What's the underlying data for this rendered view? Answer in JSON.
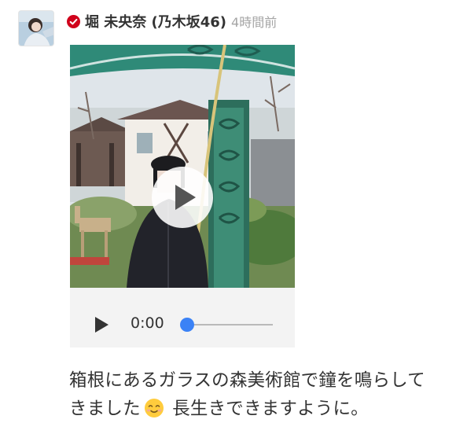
{
  "post": {
    "author": "堀 未央奈 (乃木坂46)",
    "time": "4時間前",
    "verified_icon": "verified-badge-icon",
    "verified_color": "#d0021b"
  },
  "media": {
    "overlay_icon": "play-icon",
    "audio": {
      "time": "0:00",
      "progress": 0,
      "accent_color": "#3b82f6"
    }
  },
  "caption": {
    "text_before_emoji": "箱根にあるガラスの森美術館で鐘を鳴らしてきました",
    "emoji_icon": "smiling-face-emoji-icon",
    "text_after_emoji": " 長生きできますように。"
  }
}
